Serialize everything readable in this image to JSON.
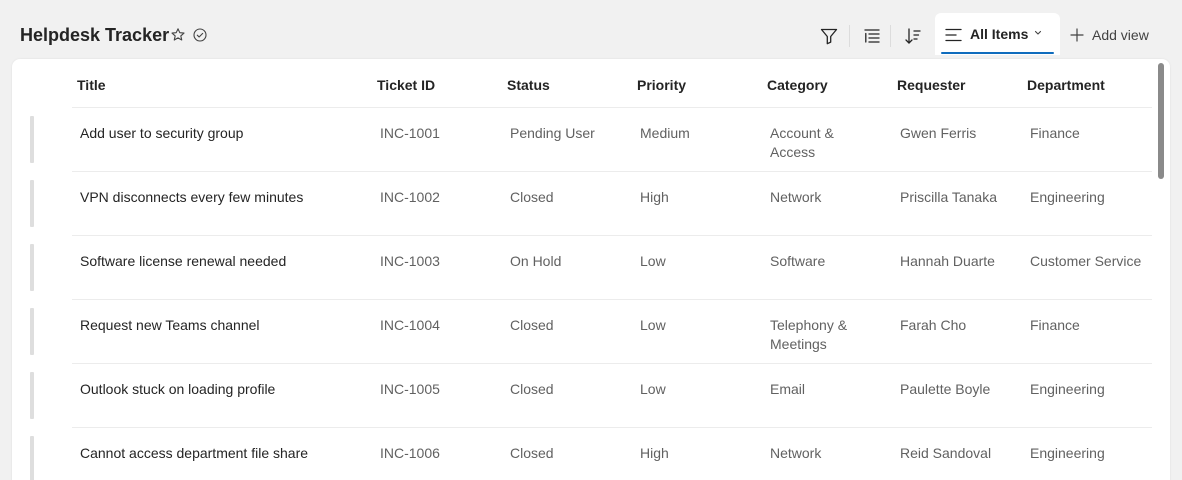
{
  "header": {
    "title": "Helpdesk Tracker",
    "icons": [
      "star-icon",
      "checkmark-circle-icon"
    ]
  },
  "toolbar": {
    "filter_icon": "filter-icon",
    "group_icon": "group-list-icon",
    "sort_icon": "sort-icon",
    "view_tab": {
      "label": "All Items",
      "icon": "list-icon",
      "chevron": "chevron-down-icon"
    },
    "add_view_label": "Add view"
  },
  "table": {
    "columns": [
      "Title",
      "Ticket ID",
      "Status",
      "Priority",
      "Category",
      "Requester",
      "Department"
    ],
    "rows": [
      {
        "title": "Add user to security group",
        "ticket_id": "INC-1001",
        "status": "Pending User",
        "priority": "Medium",
        "category": "Account & Access",
        "requester": "Gwen Ferris",
        "department": "Finance"
      },
      {
        "title": "VPN disconnects every few minutes",
        "ticket_id": "INC-1002",
        "status": "Closed",
        "priority": "High",
        "category": "Network",
        "requester": "Priscilla Tanaka",
        "department": "Engineering"
      },
      {
        "title": "Software license renewal needed",
        "ticket_id": "INC-1003",
        "status": "On Hold",
        "priority": "Low",
        "category": "Software",
        "requester": "Hannah Duarte",
        "department": "Customer Service"
      },
      {
        "title": "Request new Teams channel",
        "ticket_id": "INC-1004",
        "status": "Closed",
        "priority": "Low",
        "category": "Telephony & Meetings",
        "requester": "Farah Cho",
        "department": "Finance"
      },
      {
        "title": "Outlook stuck on loading profile",
        "ticket_id": "INC-1005",
        "status": "Closed",
        "priority": "Low",
        "category": "Email",
        "requester": "Paulette Boyle",
        "department": "Engineering"
      },
      {
        "title": "Cannot access department file share",
        "ticket_id": "INC-1006",
        "status": "Closed",
        "priority": "High",
        "category": "Network",
        "requester": "Reid Sandoval",
        "department": "Engineering"
      }
    ]
  },
  "colors": {
    "accent": "#0f6cbd",
    "text": "#242424",
    "muted": "#616161",
    "background": "#f1f1f1"
  }
}
